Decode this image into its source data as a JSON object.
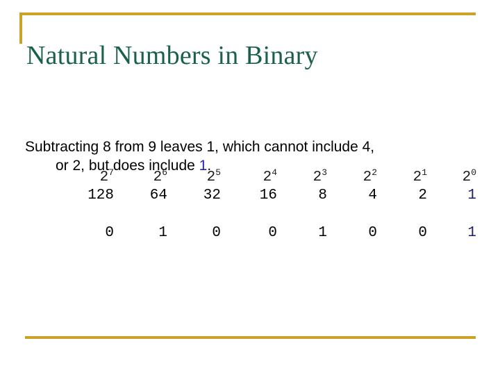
{
  "slide": {
    "title": "Natural Numbers in Binary",
    "accent_color": "#c9a227",
    "title_color": "#1a6149",
    "highlight_color": "#2222bb",
    "body": {
      "line1": "Subtracting 8 from 9 leaves 1, which cannot include 4,",
      "line2_before": "or 2, but does include ",
      "line2_highlight": "1",
      "line2_after": "."
    },
    "table": {
      "exponent_base": "2",
      "exponents": [
        "7",
        "6",
        "5",
        "4",
        "3",
        "2",
        "1",
        "0"
      ],
      "values": [
        "128",
        "64",
        "32",
        "16",
        "8",
        "4",
        "2",
        "1"
      ],
      "bits": [
        "0",
        "1",
        "0",
        "0",
        "1",
        "0",
        "0",
        "1"
      ]
    }
  }
}
